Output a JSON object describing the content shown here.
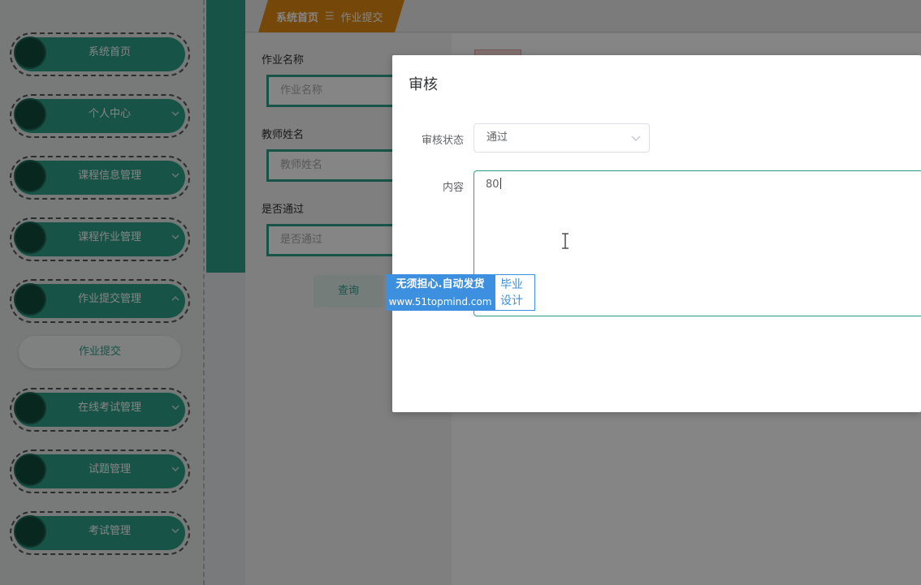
{
  "sidebar": {
    "items": [
      {
        "label": "系统首页",
        "has_arrow": false
      },
      {
        "label": "个人中心",
        "has_arrow": true,
        "arrow": "chevron-down"
      },
      {
        "label": "课程信息管理",
        "has_arrow": true,
        "arrow": "chevron-down"
      },
      {
        "label": "课程作业管理",
        "has_arrow": true,
        "arrow": "chevron-down"
      },
      {
        "label": "作业提交管理",
        "has_arrow": true,
        "arrow": "chevron-up"
      },
      {
        "label": "在线考试管理",
        "has_arrow": true,
        "arrow": "chevron-down"
      },
      {
        "label": "试题管理",
        "has_arrow": true,
        "arrow": "chevron-down"
      },
      {
        "label": "考试管理",
        "has_arrow": true,
        "arrow": "chevron-down"
      }
    ],
    "submenu_item": "作业提交"
  },
  "breadcrumb": {
    "home": "系统首页",
    "separator": "☰",
    "current": "作业提交"
  },
  "search": {
    "fields": [
      {
        "label": "作业名称",
        "placeholder": "作业名称"
      },
      {
        "label": "教师姓名",
        "placeholder": "教师姓名"
      },
      {
        "label": "是否通过",
        "placeholder": "是否通过"
      }
    ],
    "query_button": "查询"
  },
  "dialog": {
    "title": "审核",
    "status_label": "审核状态",
    "status_value": "通过",
    "content_label": "内容",
    "content_value": "80"
  },
  "watermark": {
    "line1": "无须担心.自动发货",
    "line2": "www.51topmind.com",
    "badge_line1": "毕业",
    "badge_line2": "设计"
  },
  "colors": {
    "accent": "#2e9f8a",
    "breadcrumb": "#e08a13",
    "watermark": "#3d8fe0"
  }
}
